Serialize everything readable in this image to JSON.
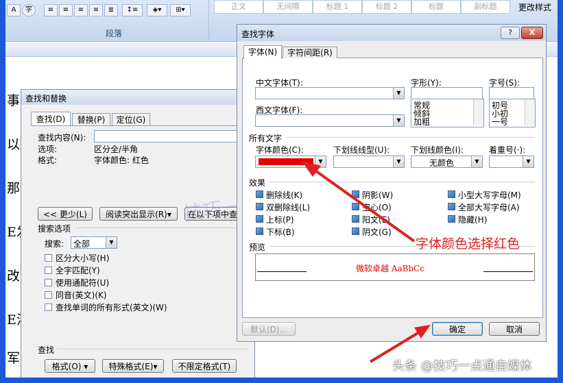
{
  "ribbon": {
    "styles": [
      "正文",
      "无间隔",
      "标题 1",
      "标题 2",
      "标题",
      "副标题"
    ],
    "change_styles": "更改样式",
    "paragraph_group": "段落",
    "circle_char": "字"
  },
  "document": {
    "chars": [
      "事",
      "以所",
      "那",
      "E发",
      "改责",
      "E法",
      "军事"
    ]
  },
  "find_replace": {
    "title": "查找和替换",
    "tabs": [
      "查找(D)",
      "替换(P)",
      "定位(G)"
    ],
    "find_label": "查找内容(N):",
    "options_label": "选项:",
    "options_value": "区分全/半角",
    "format_label": "格式:",
    "format_value": "字体颜色: 红色",
    "less_button": "<< 更少(L)",
    "highlight_button": "阅读突出显示(R)▾",
    "find_in_button": "在以下项中查找",
    "search_options": "搜索选项",
    "search_label": "搜索:",
    "search_value": "全部",
    "checkboxes": [
      "区分大小写(H)",
      "全字匹配(Y)",
      "使用通配符(U)",
      "同音(英文)(K)",
      "查找单词的所有形式(英文)(W)"
    ],
    "find_section": "查找",
    "format_button": "格式(O) ▾",
    "special_button": "特殊格式(E)▾",
    "no_format_button": "不限定格式(T)"
  },
  "find_font": {
    "title": "查找字体",
    "help": "?",
    "close": "X",
    "tabs": [
      "字体(N)",
      "字符间距(R)"
    ],
    "cn_font_label": "中文字体(T):",
    "western_font_label": "西文字体(F):",
    "style_label": "字形(Y):",
    "size_label": "字号(S):",
    "styles": [
      "常规",
      "倾斜",
      "加粗"
    ],
    "sizes": [
      "初号",
      "小初",
      "一号"
    ],
    "all_text": "所有文字",
    "color_label": "字体颜色(C):",
    "color_value": "#e60000",
    "underline_label": "下划线线型(U):",
    "underline_color_label": "下划线颜色(I):",
    "underline_color_value": "无颜色",
    "emphasis_label": "着重号(·):",
    "effects_label": "效果",
    "effects_col1": [
      "删除线(K)",
      "双删除线(L)",
      "上标(P)",
      "下标(B)"
    ],
    "effects_col2": [
      "阴影(W)",
      "空心(O)",
      "阳文(E)",
      "阴文(G)"
    ],
    "effects_col3": [
      "小型大写字母(M)",
      "全部大写字母(A)",
      "隐藏(H)"
    ],
    "preview_label": "预览",
    "preview_text": "微软卓越  AaBbCc",
    "default_button": "默认(D)...",
    "ok_button": "确定",
    "cancel_button": "取消"
  },
  "annotation": {
    "text": "字体颜色选择红色",
    "color": "#e02020"
  },
  "watermark": "头条 @技巧一点通自媒体",
  "faint_watermark": "技巧一点通"
}
